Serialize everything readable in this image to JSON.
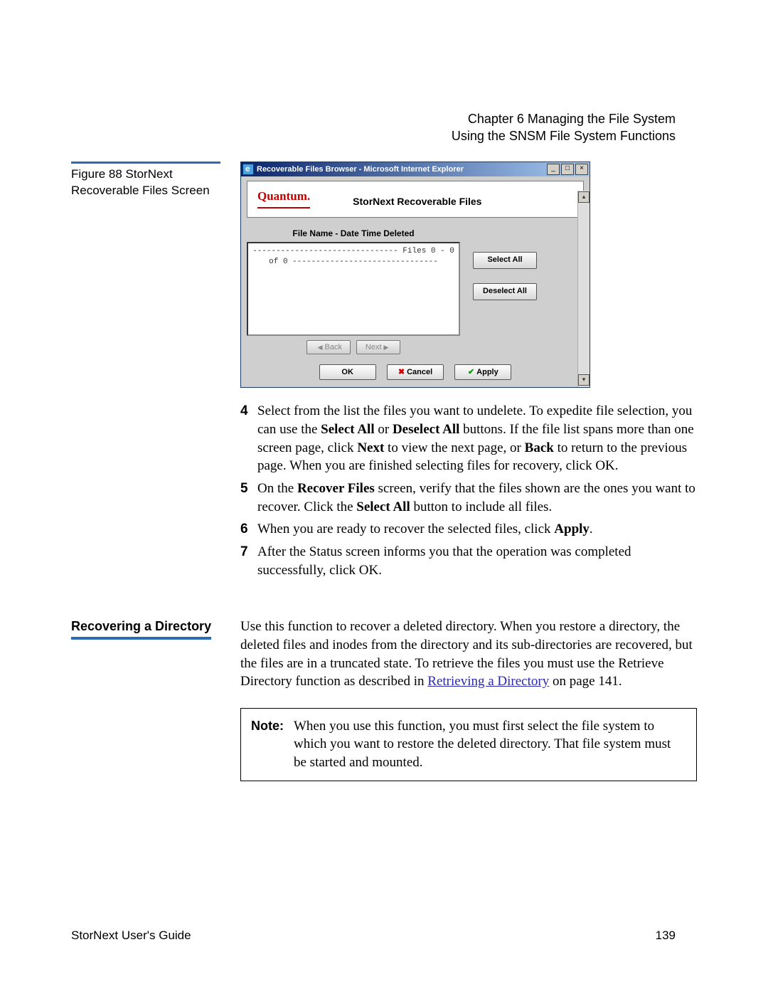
{
  "header": {
    "line1": "Chapter 6  Managing the File System",
    "line2": "Using the SNSM File System Functions"
  },
  "figure": {
    "caption_line1": "Figure 88  StorNext",
    "caption_line2": "Recoverable Files Screen"
  },
  "ie_window": {
    "title": "Recoverable Files Browser - Microsoft Internet Explorer",
    "brand": "Quantum.",
    "app_title": "StorNext Recoverable Files",
    "list_header": "File Name - Date Time Deleted",
    "list_placeholder": "------------------------------- Files 0 - 0 of 0 -------------------------------",
    "btn_select_all": "Select All",
    "btn_deselect_all": "Deselect All",
    "btn_back": "Back",
    "btn_next": "Next",
    "btn_ok": "OK",
    "btn_cancel": "Cancel",
    "btn_apply": "Apply"
  },
  "steps": {
    "s4": {
      "num": "4",
      "pre": "Select from the list the files you want to undelete. To expedite file selection, you can use the ",
      "b1": "Select All",
      "mid1": " or ",
      "b2": "Deselect All",
      "mid2": " buttons. If the file list spans more than one screen page, click ",
      "b3": "Next",
      "mid3": " to view the next page, or ",
      "b4": "Back",
      "post": " to return to the previous page. When you are finished selecting files for recovery, click OK."
    },
    "s5": {
      "num": "5",
      "pre": "On the ",
      "b1": "Recover Files",
      "mid1": " screen, verify that the files shown are the ones you want to recover. Click the ",
      "b2": "Select All",
      "post": " button to include all files."
    },
    "s6": {
      "num": "6",
      "pre": "When you are ready to recover the selected files, click ",
      "b1": "Apply",
      "post": "."
    },
    "s7": {
      "num": "7",
      "text": "After the Status screen informs you that the operation was completed successfully, click OK."
    }
  },
  "section2": {
    "heading": "Recovering a Directory",
    "para_pre": "Use this function to recover a deleted directory. When you restore a directory, the deleted files and inodes from the directory and its sub-directories are recovered, but the files are in a truncated state. To retrieve the files you must use the Retrieve Directory function as described in ",
    "link_text": "Retrieving a Directory",
    "para_post": " on page  141."
  },
  "note": {
    "label": "Note:",
    "text": "When you use this function, you must first select the file system to which you want to restore the deleted directory. That file system must be started and mounted."
  },
  "footer": {
    "left": "StorNext User's Guide",
    "right": "139"
  }
}
